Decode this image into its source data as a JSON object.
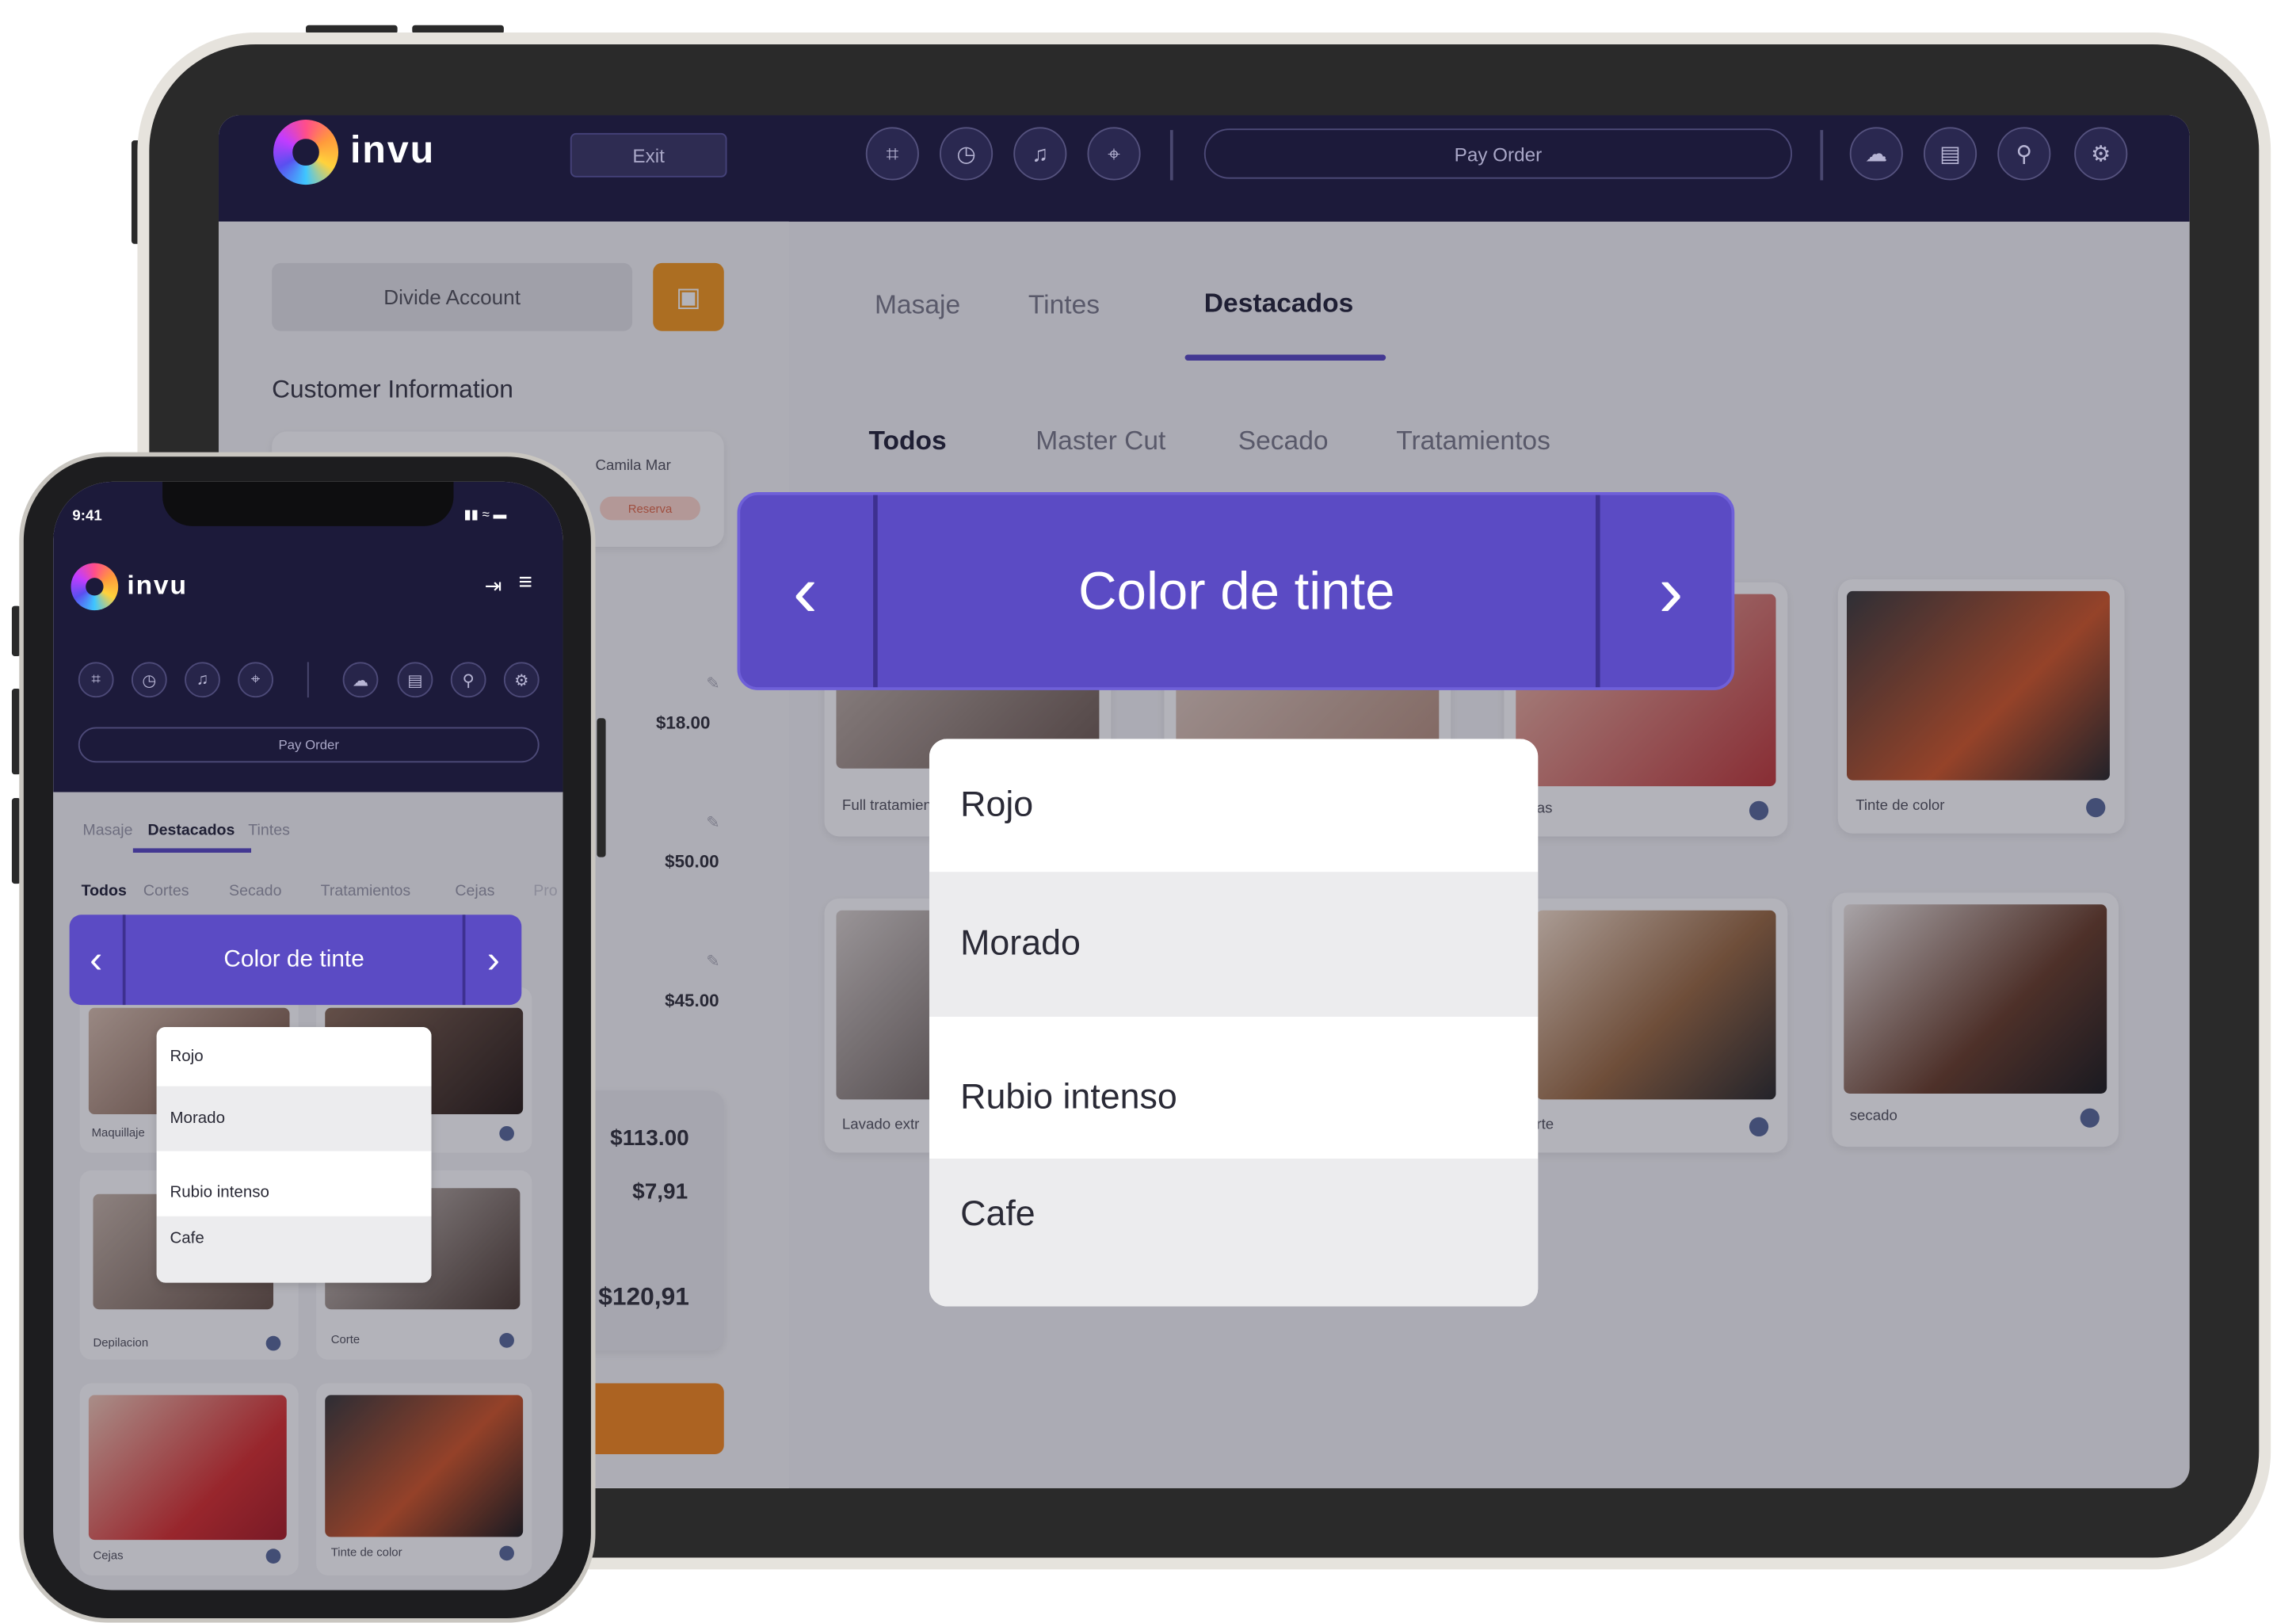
{
  "brand": {
    "name": "invu"
  },
  "tablet": {
    "topbar": {
      "exit_label": "Exit",
      "pay_order_label": "Pay Order",
      "icons_left": [
        "scan-icon",
        "clock-icon",
        "bell-icon",
        "crosshair-icon"
      ],
      "icons_right": [
        "cloud-sync-icon",
        "card-history-icon",
        "search-icon",
        "settings-icon"
      ]
    },
    "left": {
      "divide_account_label": "Divide Account",
      "customer_info_title": "Customer Information",
      "customer_name": "Camila Mar",
      "reserve_badge": "Reserva",
      "line_prices": [
        "$18.00",
        "$50.00",
        "$45.00"
      ],
      "subtotal": "$113.00",
      "tax": "$7,91",
      "total": "$120,91"
    },
    "main": {
      "tabs": [
        "Masaje",
        "Tintes",
        "Destacados"
      ],
      "active_tab": "Destacados",
      "subtabs": [
        "Todos",
        "Master Cut",
        "Secado",
        "Tratamientos"
      ],
      "active_subtab": "Todos",
      "cards_row1": [
        "Full tratamien",
        "jas",
        "Tinte de color"
      ],
      "cards_row2": [
        "Lavado extr",
        "rte",
        "secado"
      ]
    }
  },
  "dropdown": {
    "title": "Color de tinte",
    "options": [
      "Rojo",
      "Morado",
      "Rubio intenso",
      "Cafe"
    ],
    "highlighted": [
      "Morado",
      "Cafe"
    ]
  },
  "phone": {
    "status_time": "9:41",
    "pay_order_label": "Pay Order",
    "tabs": [
      "Masaje",
      "Destacados",
      "Tintes"
    ],
    "active_tab": "Destacados",
    "subtabs": [
      "Todos",
      "Cortes",
      "Secado",
      "Tratamientos",
      "Cejas",
      "Pro"
    ],
    "active_subtab": "Todos",
    "cards": [
      "Maquillaje",
      "Depilacion",
      "Corte",
      "Cejas",
      "Tinte de color"
    ]
  },
  "colors": {
    "primary": "#5b4bc4",
    "topbar": "#1c1a3a",
    "accent_orange": "#f59a1f"
  }
}
